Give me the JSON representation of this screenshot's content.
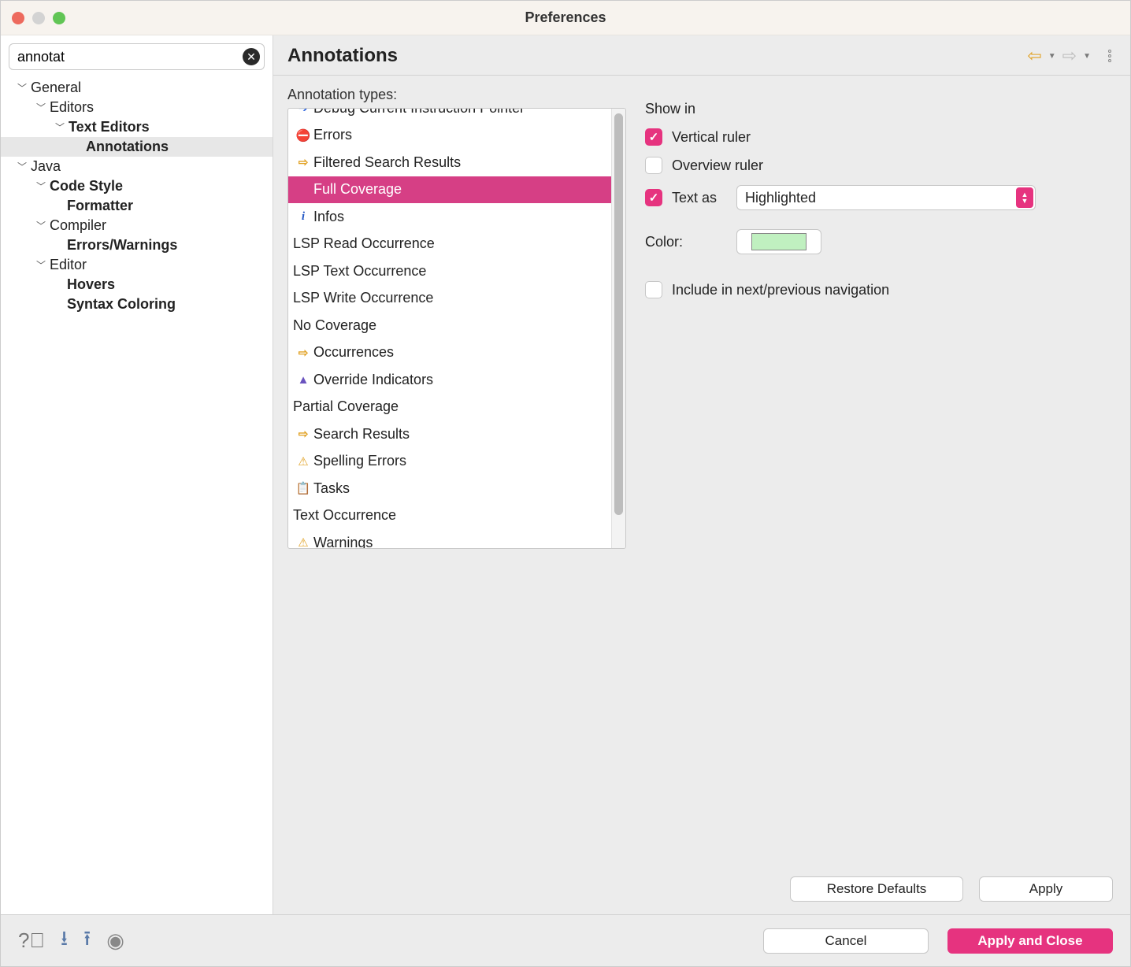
{
  "window": {
    "title": "Preferences"
  },
  "search": {
    "value": "annotat"
  },
  "tree": {
    "general": "General",
    "editors": "Editors",
    "text_editors": "Text Editors",
    "annotations": "Annotations",
    "java": "Java",
    "code_style": "Code Style",
    "formatter": "Formatter",
    "compiler": "Compiler",
    "errors_warnings": "Errors/Warnings",
    "editor": "Editor",
    "hovers": "Hovers",
    "syntax_coloring": "Syntax Coloring"
  },
  "page": {
    "title": "Annotations",
    "types_label": "Annotation types:"
  },
  "types": {
    "i0": "Debug Current Instruction Pointer",
    "i1": "Errors",
    "i2": "Filtered Search Results",
    "i3": "Full Coverage",
    "i4": "Infos",
    "i5": "LSP Read Occurrence",
    "i6": "LSP Text Occurrence",
    "i7": "LSP Write Occurrence",
    "i8": "No Coverage",
    "i9": "Occurrences",
    "i10": "Override Indicators",
    "i11": "Partial Coverage",
    "i12": "Search Results",
    "i13": "Spelling Errors",
    "i14": "Tasks",
    "i15": "Text Occurrence",
    "i16": "Warnings"
  },
  "settings": {
    "show_in_label": "Show in",
    "vertical_ruler": "Vertical ruler",
    "overview_ruler": "Overview ruler",
    "text_as_label": "Text as",
    "text_as_value": "Highlighted",
    "color_label": "Color:",
    "color_value": "#c0f0c0",
    "include_nav": "Include in next/previous navigation"
  },
  "buttons": {
    "restore": "Restore Defaults",
    "apply": "Apply",
    "cancel": "Cancel",
    "apply_close": "Apply and Close"
  }
}
